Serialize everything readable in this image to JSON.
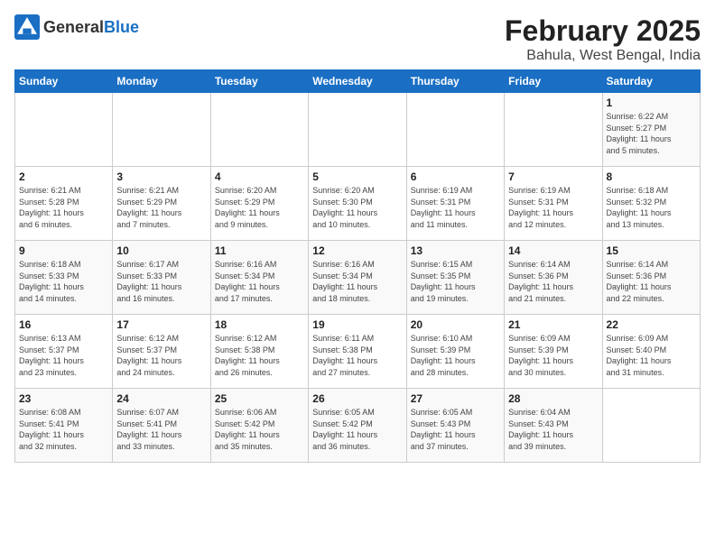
{
  "logo": {
    "general": "General",
    "blue": "Blue"
  },
  "title": "February 2025",
  "subtitle": "Bahula, West Bengal, India",
  "days_of_week": [
    "Sunday",
    "Monday",
    "Tuesday",
    "Wednesday",
    "Thursday",
    "Friday",
    "Saturday"
  ],
  "weeks": [
    [
      {
        "day": "",
        "info": ""
      },
      {
        "day": "",
        "info": ""
      },
      {
        "day": "",
        "info": ""
      },
      {
        "day": "",
        "info": ""
      },
      {
        "day": "",
        "info": ""
      },
      {
        "day": "",
        "info": ""
      },
      {
        "day": "1",
        "info": "Sunrise: 6:22 AM\nSunset: 5:27 PM\nDaylight: 11 hours\nand 5 minutes."
      }
    ],
    [
      {
        "day": "2",
        "info": "Sunrise: 6:21 AM\nSunset: 5:28 PM\nDaylight: 11 hours\nand 6 minutes."
      },
      {
        "day": "3",
        "info": "Sunrise: 6:21 AM\nSunset: 5:29 PM\nDaylight: 11 hours\nand 7 minutes."
      },
      {
        "day": "4",
        "info": "Sunrise: 6:20 AM\nSunset: 5:29 PM\nDaylight: 11 hours\nand 9 minutes."
      },
      {
        "day": "5",
        "info": "Sunrise: 6:20 AM\nSunset: 5:30 PM\nDaylight: 11 hours\nand 10 minutes."
      },
      {
        "day": "6",
        "info": "Sunrise: 6:19 AM\nSunset: 5:31 PM\nDaylight: 11 hours\nand 11 minutes."
      },
      {
        "day": "7",
        "info": "Sunrise: 6:19 AM\nSunset: 5:31 PM\nDaylight: 11 hours\nand 12 minutes."
      },
      {
        "day": "8",
        "info": "Sunrise: 6:18 AM\nSunset: 5:32 PM\nDaylight: 11 hours\nand 13 minutes."
      }
    ],
    [
      {
        "day": "9",
        "info": "Sunrise: 6:18 AM\nSunset: 5:33 PM\nDaylight: 11 hours\nand 14 minutes."
      },
      {
        "day": "10",
        "info": "Sunrise: 6:17 AM\nSunset: 5:33 PM\nDaylight: 11 hours\nand 16 minutes."
      },
      {
        "day": "11",
        "info": "Sunrise: 6:16 AM\nSunset: 5:34 PM\nDaylight: 11 hours\nand 17 minutes."
      },
      {
        "day": "12",
        "info": "Sunrise: 6:16 AM\nSunset: 5:34 PM\nDaylight: 11 hours\nand 18 minutes."
      },
      {
        "day": "13",
        "info": "Sunrise: 6:15 AM\nSunset: 5:35 PM\nDaylight: 11 hours\nand 19 minutes."
      },
      {
        "day": "14",
        "info": "Sunrise: 6:14 AM\nSunset: 5:36 PM\nDaylight: 11 hours\nand 21 minutes."
      },
      {
        "day": "15",
        "info": "Sunrise: 6:14 AM\nSunset: 5:36 PM\nDaylight: 11 hours\nand 22 minutes."
      }
    ],
    [
      {
        "day": "16",
        "info": "Sunrise: 6:13 AM\nSunset: 5:37 PM\nDaylight: 11 hours\nand 23 minutes."
      },
      {
        "day": "17",
        "info": "Sunrise: 6:12 AM\nSunset: 5:37 PM\nDaylight: 11 hours\nand 24 minutes."
      },
      {
        "day": "18",
        "info": "Sunrise: 6:12 AM\nSunset: 5:38 PM\nDaylight: 11 hours\nand 26 minutes."
      },
      {
        "day": "19",
        "info": "Sunrise: 6:11 AM\nSunset: 5:38 PM\nDaylight: 11 hours\nand 27 minutes."
      },
      {
        "day": "20",
        "info": "Sunrise: 6:10 AM\nSunset: 5:39 PM\nDaylight: 11 hours\nand 28 minutes."
      },
      {
        "day": "21",
        "info": "Sunrise: 6:09 AM\nSunset: 5:39 PM\nDaylight: 11 hours\nand 30 minutes."
      },
      {
        "day": "22",
        "info": "Sunrise: 6:09 AM\nSunset: 5:40 PM\nDaylight: 11 hours\nand 31 minutes."
      }
    ],
    [
      {
        "day": "23",
        "info": "Sunrise: 6:08 AM\nSunset: 5:41 PM\nDaylight: 11 hours\nand 32 minutes."
      },
      {
        "day": "24",
        "info": "Sunrise: 6:07 AM\nSunset: 5:41 PM\nDaylight: 11 hours\nand 33 minutes."
      },
      {
        "day": "25",
        "info": "Sunrise: 6:06 AM\nSunset: 5:42 PM\nDaylight: 11 hours\nand 35 minutes."
      },
      {
        "day": "26",
        "info": "Sunrise: 6:05 AM\nSunset: 5:42 PM\nDaylight: 11 hours\nand 36 minutes."
      },
      {
        "day": "27",
        "info": "Sunrise: 6:05 AM\nSunset: 5:43 PM\nDaylight: 11 hours\nand 37 minutes."
      },
      {
        "day": "28",
        "info": "Sunrise: 6:04 AM\nSunset: 5:43 PM\nDaylight: 11 hours\nand 39 minutes."
      },
      {
        "day": "",
        "info": ""
      }
    ]
  ]
}
